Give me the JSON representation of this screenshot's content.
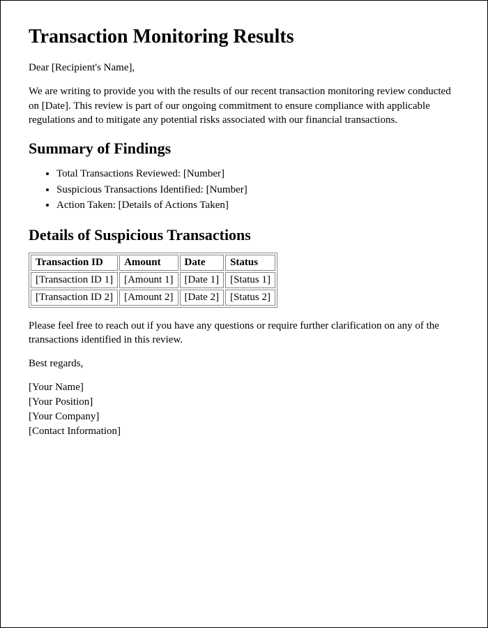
{
  "title": "Transaction Monitoring Results",
  "greeting": "Dear [Recipient's Name],",
  "intro": "We are writing to provide you with the results of our recent transaction monitoring review conducted on [Date]. This review is part of our ongoing commitment to ensure compliance with applicable regulations and to mitigate any potential risks associated with our financial transactions.",
  "summary_heading": "Summary of Findings",
  "summary_items": [
    "Total Transactions Reviewed: [Number]",
    "Suspicious Transactions Identified: [Number]",
    "Action Taken: [Details of Actions Taken]"
  ],
  "details_heading": "Details of Suspicious Transactions",
  "table_headers": [
    "Transaction ID",
    "Amount",
    "Date",
    "Status"
  ],
  "table_rows": [
    [
      "[Transaction ID 1]",
      "[Amount 1]",
      "[Date 1]",
      "[Status 1]"
    ],
    [
      "[Transaction ID 2]",
      "[Amount 2]",
      "[Date 2]",
      "[Status 2]"
    ]
  ],
  "closing_para": "Please feel free to reach out if you have any questions or require further clarification on any of the transactions identified in this review.",
  "signoff": "Best regards,",
  "signature": [
    "[Your Name]",
    "[Your Position]",
    "[Your Company]",
    "[Contact Information]"
  ]
}
